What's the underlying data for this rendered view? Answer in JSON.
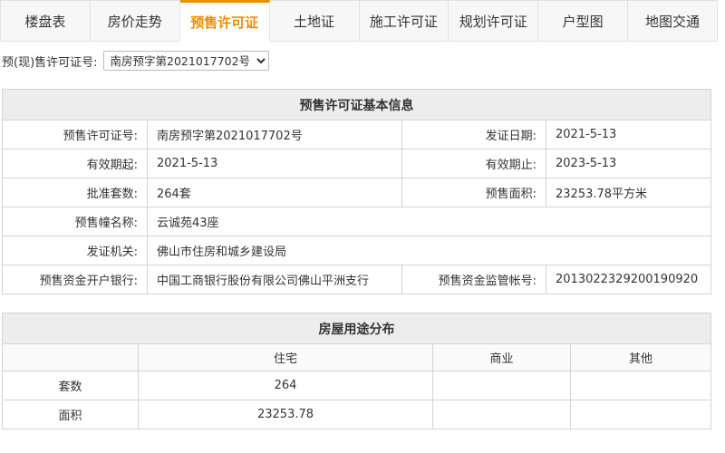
{
  "tabs": [
    {
      "label": "楼盘表"
    },
    {
      "label": "房价走势"
    },
    {
      "label": "预售许可证"
    },
    {
      "label": "土地证"
    },
    {
      "label": "施工许可证"
    },
    {
      "label": "规划许可证"
    },
    {
      "label": "户型图"
    },
    {
      "label": "地图交通"
    }
  ],
  "active_tab_color": "#f08c00",
  "permit_selector": {
    "label": "预(现)售许可证号:",
    "selected": "南房预字第2021017702号"
  },
  "basic_info": {
    "title": "预售许可证基本信息",
    "permit_no_label": "预售许可证号:",
    "permit_no": "南房预字第2021017702号",
    "issue_date_label": "发证日期:",
    "issue_date": "2021-5-13",
    "valid_from_label": "有效期起:",
    "valid_from": "2021-5-13",
    "valid_to_label": "有效期止:",
    "valid_to": "2023-5-13",
    "approved_units_label": "批准套数:",
    "approved_units": "264套",
    "presale_area_label": "预售面积:",
    "presale_area": "23253.78平方米",
    "building_name_label": "预售幢名称:",
    "building_name": "云诚苑43座",
    "issuer_label": "发证机关:",
    "issuer": "佛山市住房和城乡建设局",
    "bank_label": "预售资金开户银行:",
    "bank": "中国工商银行股份有限公司佛山平洲支行",
    "account_label": "预售资金监管帐号:",
    "account": "2013022329200190920"
  },
  "usage": {
    "title": "房屋用途分布",
    "columns": [
      "",
      "住宅",
      "商业",
      "其他"
    ],
    "rows": [
      {
        "label": "套数",
        "residential": "264",
        "commercial": "",
        "other": ""
      },
      {
        "label": "面积",
        "residential": "23253.78",
        "commercial": "",
        "other": ""
      }
    ]
  }
}
